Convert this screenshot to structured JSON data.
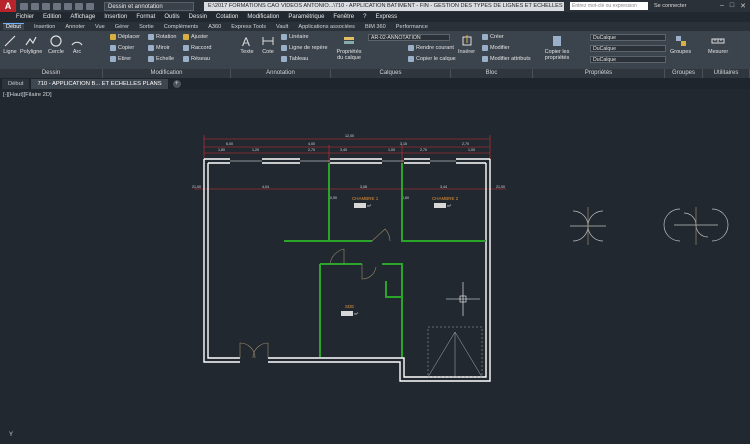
{
  "titlebar": {
    "logo": "A",
    "workspace": "Dessin et annotation",
    "title": "E:\\2017 FORMATIONS CAO VIDEOS ANTONIO...\\710 - APPLICATION BATIMENT - FIN - GESTION DES TYPES DE LIGNES ET ECHELLES PLANS.dwg",
    "search_placeholder": "Entrez mot-clé ou expression",
    "connect": "Se connecter"
  },
  "menu": [
    "Fichier",
    "Edition",
    "Affichage",
    "Insertion",
    "Format",
    "Outils",
    "Dessin",
    "Cotation",
    "Modification",
    "Paramétrique",
    "Fenêtre",
    "?",
    "Express"
  ],
  "ribbon_tabs": [
    "Début",
    "Insertion",
    "Annoter",
    "Vue",
    "Gérer",
    "Sortie",
    "Compléments",
    "A360",
    "Express Tools",
    "Vault",
    "Applications associées",
    "BIM 360",
    "Performance"
  ],
  "ribbon": {
    "draw": [
      "Ligne",
      "Polyligne",
      "Cercle",
      "Arc"
    ],
    "modify": [
      "Déplacer",
      "Copier",
      "Etirer",
      "Rotation",
      "Miroir",
      "Echelle",
      "Ajuster",
      "Raccord",
      "Réseau"
    ],
    "annotation": [
      "Texte",
      "Cote",
      "Linéaire",
      "Ligne de repère",
      "Tableau"
    ],
    "layers": {
      "props": "Propriétés du calque",
      "current": "AR-02-ANNOTATION",
      "make_current": "Rendre courant",
      "copy_layer": "Copier le calque"
    },
    "block": {
      "insert": "Insérer",
      "create": "Créer",
      "modify": "Modifier",
      "attributes": "Modifier attributs"
    },
    "properties": {
      "copy": "Copier les propriétés",
      "value1": "DuCalque",
      "value2": "DuCalque",
      "value3": "DuCalque"
    },
    "groups": "Groupes",
    "measure": "Mesurer"
  },
  "panels": [
    "Dessin",
    "Modification",
    "Annotation",
    "Calques",
    "Bloc",
    "Propriétés",
    "Groupes",
    "Utilitaires"
  ],
  "doc_tabs": [
    "Début",
    "710 - APPLICATION B... ET ECHELLES PLANS"
  ],
  "viewport_label": "[-][Haut][Filaire 2D]",
  "ucs_label": "Y",
  "plan": {
    "overall_dim": "12,00",
    "dims_row1": [
      "6,00",
      "4,00",
      "3,15",
      "2,70"
    ],
    "dims_row2": [
      "1,80",
      "1,20",
      "2,70",
      "3,40",
      "1,00",
      "2,70",
      "1,00"
    ],
    "section_dims": [
      "21,00",
      "4,04",
      "3,08",
      "3,44",
      "21,00"
    ],
    "inner_dims": [
      "0,90",
      "0,60"
    ],
    "rooms": [
      {
        "name": "CHAMBRE 1",
        "area": "m²"
      },
      {
        "name": "CHAMBRE 2",
        "area": "m²"
      },
      {
        "name": "SDE",
        "area": "m²"
      }
    ]
  },
  "colors": {
    "background": "#212830",
    "walls": "#ffffff",
    "partitions": "#2aa52a",
    "dimensions": "#d03030",
    "rooms_text": "#e09030",
    "doors": "#9a8a6a"
  }
}
